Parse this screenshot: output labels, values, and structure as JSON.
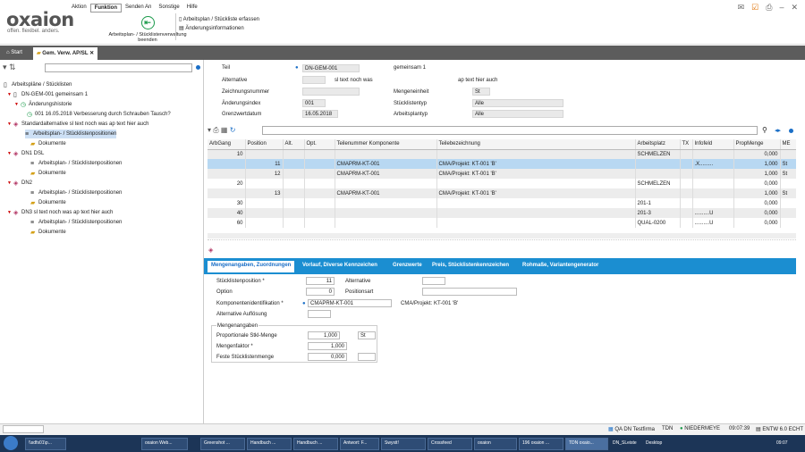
{
  "app": {
    "logo": "oxaion",
    "tagline": "offen. flexibel. anders."
  },
  "menu": [
    "Aktion",
    "Funktion",
    "Senden An",
    "Sonstige",
    "Hilfe"
  ],
  "ribbon": {
    "end_button": "Arbeitsplan- / Stücklistenverwaltung beenden",
    "links": [
      "Arbeitsplan / Stückliste erfassen",
      "Änderungsinformationen"
    ]
  },
  "tabs": [
    {
      "label": "Start"
    },
    {
      "label": "Gem. Verw. AP/SL"
    }
  ],
  "tree": [
    {
      "label": "Arbeitspläne / Stücklisten",
      "level": 0
    },
    {
      "label": "DN-GEM-001  gemeinsam 1",
      "level": 1
    },
    {
      "label": "Änderungshistorie",
      "level": 2
    },
    {
      "label": "001  16.05.2018  Verbesserung durch Schrauben Tausch?",
      "level": 3
    },
    {
      "label": "Standardalternative  sl text noch was  ap text hier auch",
      "level": 2
    },
    {
      "label": "Arbeitsplan- / Stücklistenpositionen",
      "level": 3
    },
    {
      "label": "Dokumente",
      "level": 3
    },
    {
      "label": "DN1  DSL",
      "level": 2
    },
    {
      "label": "Arbeitsplan- / Stücklistenpositionen",
      "level": 3
    },
    {
      "label": "Dokumente",
      "level": 3
    },
    {
      "label": "DN2",
      "level": 2
    },
    {
      "label": "Arbeitsplan- / Stücklistenpositionen",
      "level": 3
    },
    {
      "label": "Dokumente",
      "level": 3
    },
    {
      "label": "DN3  sl text noch was  ap text hier auch",
      "level": 2
    },
    {
      "label": "Arbeitsplan- / Stücklistenpositionen",
      "level": 3
    },
    {
      "label": "Dokumente",
      "level": 3
    }
  ],
  "header": {
    "teil_label": "Teil",
    "teil_value": "DN-GEM-001",
    "teil_desc": "gemeinsam 1",
    "alternative_label": "Alternative",
    "alt_sl_text": "sl text noch was",
    "alt_ap_text": "ap text hier auch",
    "zeichnung_label": "Zeichnungsnummer",
    "mengeneinheit_label": "Mengeneinheit",
    "mengeneinheit_value": "St",
    "aenderung_label": "Änderungsindex",
    "aenderung_value": "001",
    "stuecklistentyp_label": "Stücklistentyp",
    "stuecklistentyp_value": "Alle",
    "grenzwert_label": "Grenzwertdatum",
    "grenzwert_value": "16.05.2018",
    "arbeitsplantyp_label": "Arbeitsplantyp",
    "arbeitsplantyp_value": "Alle"
  },
  "grid": {
    "columns": [
      "ArbGang",
      "Position",
      "Alt.",
      "Opt.",
      "Teilenummer Komponente",
      "Teilebezeichnung",
      "Arbeitsplatz",
      "TX",
      "Infofeld",
      "PropMenge",
      "ME"
    ],
    "rows": [
      [
        "10",
        "",
        "",
        "",
        "",
        "",
        "SCHMELZEN",
        "",
        "",
        "0,000",
        ""
      ],
      [
        "",
        "11",
        "",
        "",
        "CMAPRM-KT-001",
        "CMA/Projekt: KT-001 'B'",
        "",
        "",
        ".X.........",
        "1,000",
        "St"
      ],
      [
        "",
        "12",
        "",
        "",
        "CMAPRM-KT-001",
        "CMA/Projekt: KT-001 'B'",
        "",
        "",
        "",
        "1,000",
        "St"
      ],
      [
        "20",
        "",
        "",
        "",
        "",
        "",
        "SCHMELZEN",
        "",
        "",
        "0,000",
        ""
      ],
      [
        "",
        "13",
        "",
        "",
        "CMAPRM-KT-001",
        "CMA/Projekt: KT-001 'B'",
        "",
        "",
        "",
        "1,000",
        "St"
      ],
      [
        "30",
        "",
        "",
        "",
        "",
        "",
        "201-1",
        "",
        "",
        "0,000",
        ""
      ],
      [
        "40",
        "",
        "",
        "",
        "",
        "",
        "201-3",
        "",
        "..........U",
        "0,000",
        ""
      ],
      [
        "60",
        "",
        "",
        "",
        "",
        "",
        "QUAL-0200",
        "",
        "..........U",
        "0,000",
        ""
      ]
    ]
  },
  "panel_tabs": [
    "Mengenangaben, Zuordnungen",
    "Vorlauf, Diverse Kennzeichen",
    "Grenzwerte",
    "Preis, Stücklistenkennzeichen",
    "Rohmaße, Variantengenerator"
  ],
  "detail": {
    "stueckpos_label": "Stücklistenposition *",
    "stueckpos_value": "11",
    "alternative_label": "Alternative",
    "option_label": "Option",
    "option_value": "0",
    "positionsart_label": "Positionsart",
    "komp_label": "Komponentenidentifikation *",
    "komp_value": "CMAPRM-KT-001",
    "komp_desc": "CMA/Projekt: KT-001 'B'",
    "altaufl_label": "Alternative Auflösung",
    "group_title": "Mengenangaben",
    "prop_label": "Proportionale Stkl-Menge",
    "prop_value": "1,000",
    "prop_unit": "St",
    "faktor_label": "Mengenfaktor *",
    "faktor_value": "1,000",
    "fest_label": "Feste Stücklistenmenge",
    "fest_value": "0,000"
  },
  "status": {
    "company": "QA DN Testfirma",
    "user": "TDN",
    "server": "NIEDERMEYE",
    "time": "09:07:39",
    "version": "ENTW 6.0 ECHT"
  },
  "taskbar": [
    "\\\\sdfs01\\p...",
    "oxaion Web...",
    "Greenshot ...",
    "Handbuch ...",
    "Handbuch ...",
    "Antwort: F...",
    "Swyxit!",
    "Crossfeed",
    "oxaion",
    "196 oxaion ...",
    "TDN oxaio...",
    "DN_SLeiste",
    "Desktop",
    "09:07"
  ]
}
